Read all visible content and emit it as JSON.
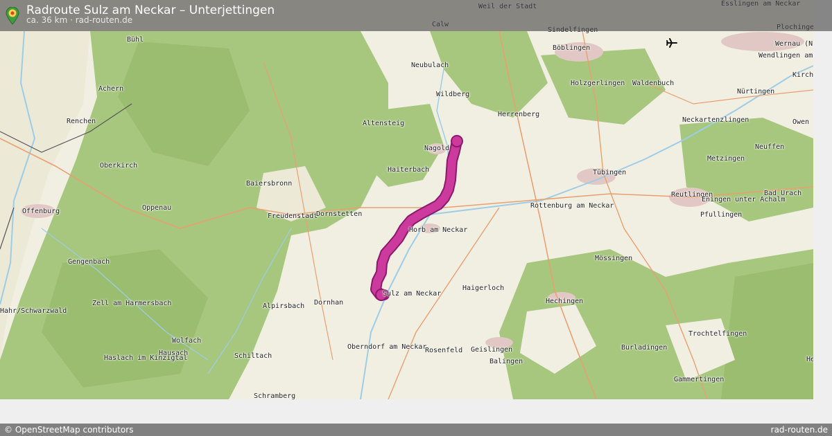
{
  "header": {
    "title": "Radroute Sulz am Neckar – Unterjettingen",
    "subtitle": "ca. 36 km · rad-routen.de",
    "icon": "map-pin-icon"
  },
  "footer": {
    "attribution": "© OpenStreetMap contributors",
    "site": "rad-routen.de"
  },
  "map": {
    "places": [
      "Weil der Stadt",
      "Esslingen am Neckar",
      "Calw",
      "Sindelfingen",
      "Plochinge",
      "Bühl",
      "Böblingen",
      "Wernau (N",
      "Wendlingen am Neckar",
      "Neubulach",
      "Achern",
      "Holzgerlingen",
      "Waldenbuch",
      "Kirch",
      "Wildberg",
      "Nürtingen",
      "Herrenberg",
      "Renchen",
      "Altensteig",
      "Neckartenzlingen",
      "Owen",
      "Nagold",
      "Neuffen",
      "Oberkirch",
      "Haiterbach",
      "Tübingen",
      "Metzingen",
      "Baiersbronn",
      "Bad Urach",
      "Reutlingen",
      "Offenburg",
      "Oppenau",
      "Freudenstadt",
      "Dornstetten",
      "Rottenburg am Neckar",
      "Eningen unter Achalm",
      "Pfullingen",
      "Horb am Neckar",
      "Gengenbach",
      "Mössingen",
      "Haigerloch",
      "Sulz am Neckar",
      "Zell am Harmersbach",
      "Alpirsbach",
      "Dornhan",
      "Hechingen",
      "Hahr/Schwarzwald",
      "Wolfach",
      "Oberndorf am Neckar",
      "Rosenfeld",
      "Geislingen",
      "Balingen",
      "Burladingen",
      "Trochtelfingen",
      "Hausach",
      "Haslach im Kinzigtal",
      "Schiltach",
      "Hei",
      "Gammertingen",
      "Schramberg"
    ],
    "colors": {
      "forest": "#a7c77e",
      "open_land": "#f1efe2",
      "urban": "#e2c8c4",
      "water": "#9dcde6",
      "main_road": "#e8a070",
      "route": "#cd3a9d",
      "route_outline": "#8a1a6a"
    },
    "airport_icon": "airplane-icon"
  }
}
